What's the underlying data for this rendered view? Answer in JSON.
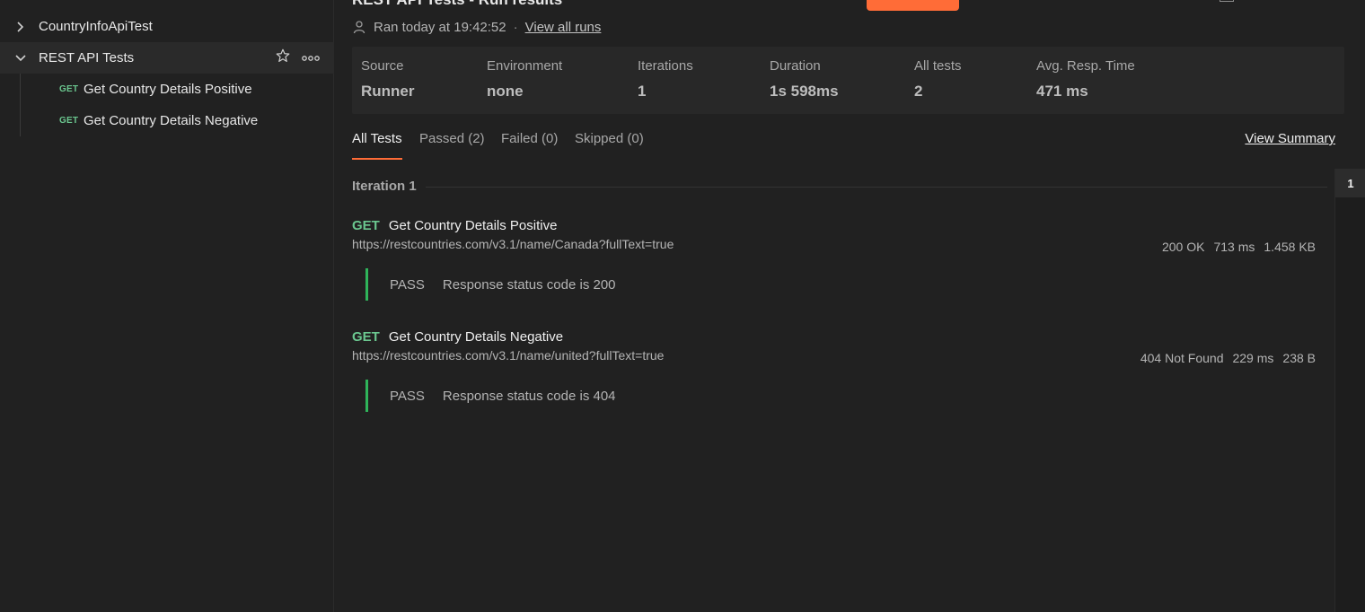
{
  "sidebar": {
    "collections": [
      {
        "label": "CountryInfoApiTest",
        "expanded": false
      },
      {
        "label": "REST API Tests",
        "expanded": true
      }
    ],
    "requests": [
      {
        "method": "GET",
        "name": "Get Country Details Positive"
      },
      {
        "method": "GET",
        "name": "Get Country Details Negative"
      }
    ]
  },
  "header": {
    "title": "REST API Tests - Run results",
    "ran_text": "Ran today at 19:42:52",
    "separator": "·",
    "view_all_runs": "View all runs"
  },
  "summary": {
    "source_label": "Source",
    "source_value": "Runner",
    "environment_label": "Environment",
    "environment_value": "none",
    "iterations_label": "Iterations",
    "iterations_value": "1",
    "duration_label": "Duration",
    "duration_value": "1s 598ms",
    "all_tests_label": "All tests",
    "all_tests_value": "2",
    "avg_resp_label": "Avg. Resp. Time",
    "avg_resp_value": "471 ms"
  },
  "tabs": {
    "all": "All Tests",
    "passed": "Passed (2)",
    "failed": "Failed (0)",
    "skipped": "Skipped (0)",
    "view_summary": "View Summary"
  },
  "iteration": {
    "label": "Iteration 1",
    "results": [
      {
        "method": "GET",
        "name": "Get Country Details Positive",
        "url": "https://restcountries.com/v3.1/name/Canada?fullText=true",
        "status": "200 OK",
        "time": "713 ms",
        "size": "1.458 KB",
        "test_status": "PASS",
        "test_name": "Response status code is 200"
      },
      {
        "method": "GET",
        "name": "Get Country Details Negative",
        "url": "https://restcountries.com/v3.1/name/united?fullText=true",
        "status": "404 Not Found",
        "time": "229 ms",
        "size": "238 B",
        "test_status": "PASS",
        "test_name": "Response status code is 404"
      }
    ]
  },
  "rail": {
    "item": "1"
  },
  "colors": {
    "accent": "#ff6c37",
    "get_method": "#6bc78f",
    "pass_bar": "#2fb45a"
  }
}
